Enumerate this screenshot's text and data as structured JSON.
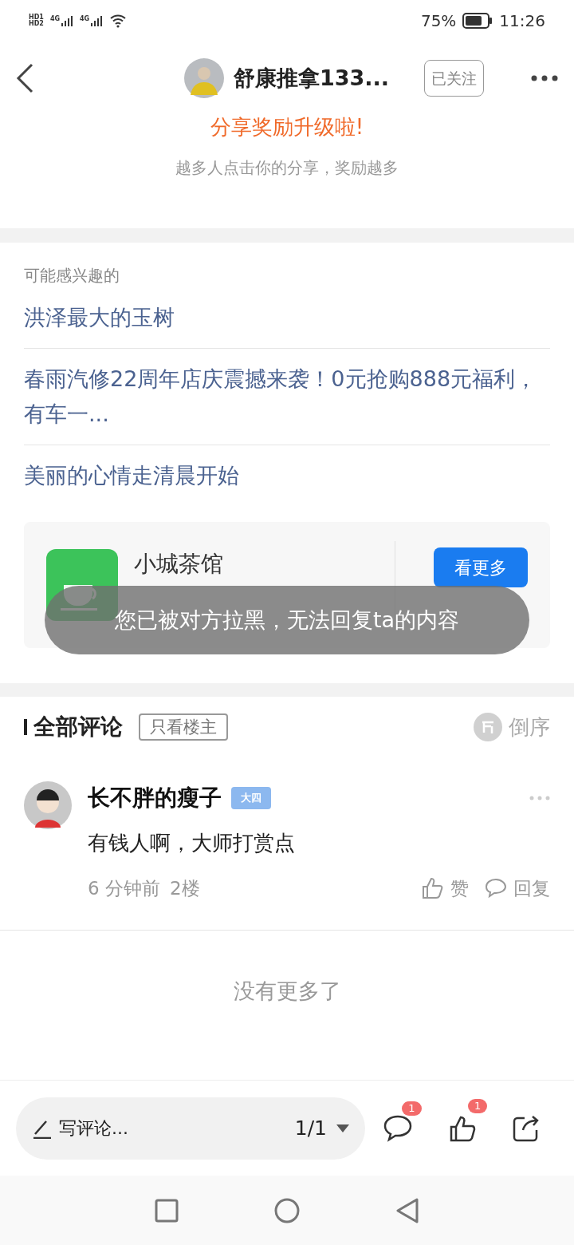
{
  "status_bar": {
    "sim_badges": [
      "HD1",
      "HD2"
    ],
    "networks": [
      "4G",
      "4G"
    ],
    "battery": "75%",
    "time": "11:26"
  },
  "header": {
    "author": "舒康推拿133...",
    "follow_label": "已关注",
    "followed": true,
    "promo_title": "分享奖励升级啦!",
    "promo_subtitle": "越多人点击你的分享，奖励越多"
  },
  "recommendations": {
    "title": "可能感兴趣的",
    "items": [
      "洪泽最大的玉树",
      "春雨汽修22周年店庆震撼来袭！0元抢购888元福利，有车一...",
      "美丽的心情走清晨开始"
    ],
    "card": {
      "name": "小城茶馆",
      "button": "看更多"
    }
  },
  "toast": "您已被对方拉黑，无法回复ta的内容",
  "comments_section": {
    "title": "全部评论",
    "filter": "只看楼主",
    "sort": "倒序",
    "comments": [
      {
        "user": "长不胖的瘦子",
        "badge": "大四",
        "text": "有钱人啊，大师打赏点",
        "time": "6 分钟前",
        "floor": "2楼",
        "like_label": "赞",
        "reply_label": "回复"
      }
    ],
    "end_text": "没有更多了"
  },
  "bottom_bar": {
    "placeholder": "写评论...",
    "page": "1/1",
    "comment_count": "1",
    "like_count": "1"
  }
}
